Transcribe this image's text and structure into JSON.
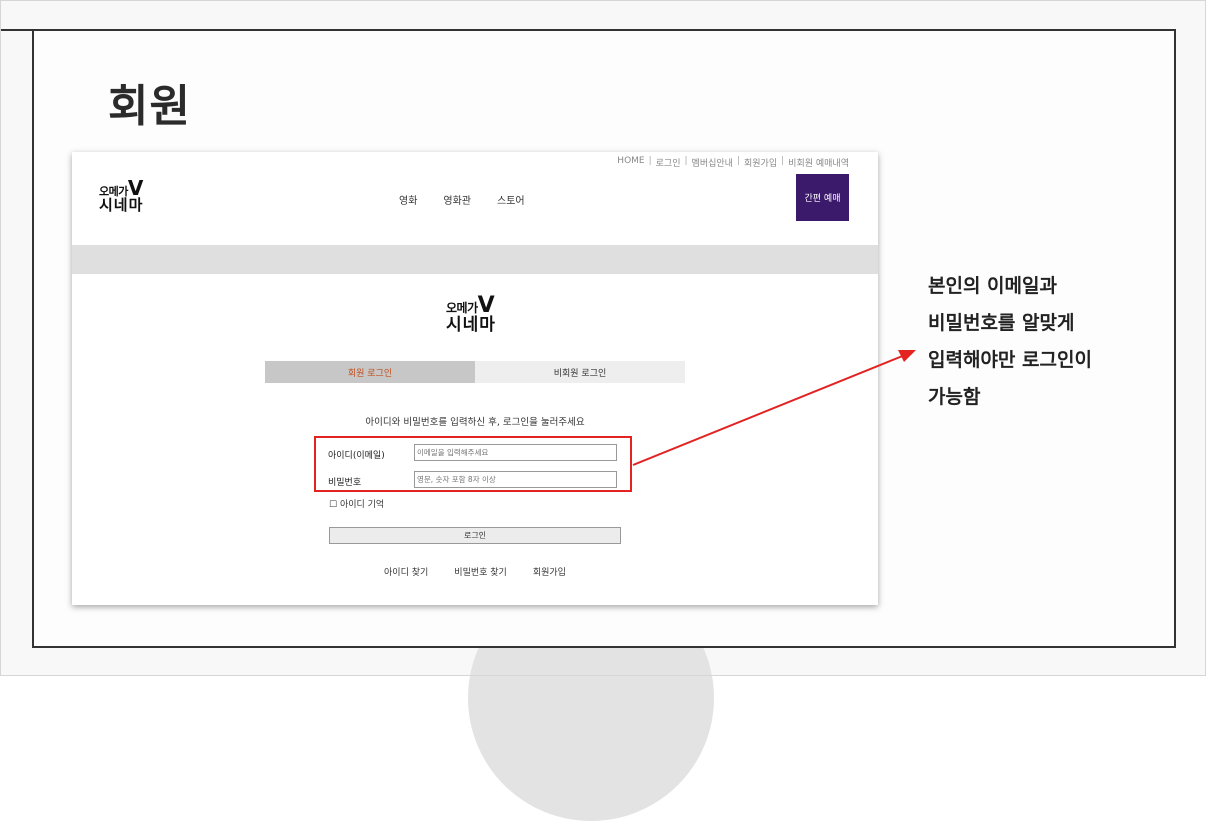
{
  "slide": {
    "title": "회원",
    "annotation_lines": [
      "본인의 이메일과",
      "비밀번호를 알맞게",
      "입력해야만 로그인이",
      "가능함"
    ]
  },
  "site": {
    "util_nav": [
      "HOME",
      "로그인",
      "멤버십안내",
      "회원가입",
      "비회원 예매내역"
    ],
    "logo_line1": "오메가",
    "logo_v": "V",
    "logo_line2": "시네마",
    "main_nav": [
      "영화",
      "영화관",
      "스토어"
    ],
    "quick_booking_label": "간편 예매"
  },
  "login": {
    "tabs": [
      "회원 로그인",
      "비회원 로그인"
    ],
    "instruction": "아이디와 비밀번호를 입력하신 후, 로그인을 눌러주세요",
    "id_label": "아이디(이메일)",
    "id_placeholder": "이메일을 입력해주세요",
    "pw_label": "비밀번호",
    "pw_placeholder": "영문, 숫자 포함 8자 이상",
    "remember_label": "아이디 기억",
    "login_button": "로그인",
    "links": [
      "아이디 찾기",
      "비밀번호 찾기",
      "회원가입"
    ]
  },
  "colors": {
    "accent_purple": "#3b1a6b",
    "active_tab_text": "#c0501f",
    "highlight_red": "#e32222"
  }
}
